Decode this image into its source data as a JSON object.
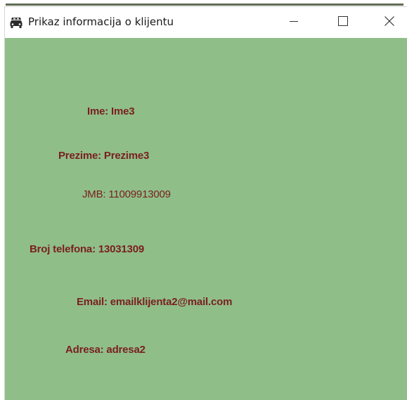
{
  "window": {
    "title": "Prikaz informacija o klijentu",
    "app_icon": "car-icon",
    "controls": {
      "minimize": "minimize-icon",
      "maximize": "maximize-icon",
      "close": "close-icon"
    }
  },
  "client": {
    "ime": "Ime: Ime3",
    "prezime": "Prezime: Prezime3",
    "jmb": "JMB: 11009913009",
    "telefon": "Broj telefona: 13031309",
    "email": "Email: emailklijenta2@mail.com",
    "adresa": "Adresa: adresa2"
  },
  "colors": {
    "background": "#8fbe89",
    "text": "#7a1f1f",
    "titlebar": "#ffffff"
  }
}
